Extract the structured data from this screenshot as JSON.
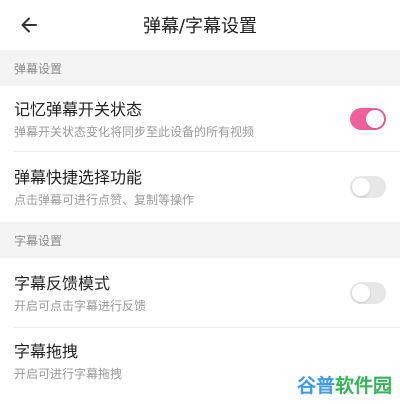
{
  "header": {
    "title": "弹幕/字幕设置",
    "back_icon": "arrow-left-icon"
  },
  "sections": [
    {
      "label": "弹幕设置",
      "items": [
        {
          "title": "记忆弹幕开关状态",
          "desc": "弹幕开关状态变化将同步至此设备的所有视频",
          "on": true
        },
        {
          "title": "弹幕快捷选择功能",
          "desc": "点击弹幕可进行点赞、复制等操作",
          "on": false
        }
      ]
    },
    {
      "label": "字幕设置",
      "items": [
        {
          "title": "字幕反馈模式",
          "desc": "开启可点击字幕进行反馈",
          "on": false
        },
        {
          "title": "字幕拖拽",
          "desc": "开启可进行字幕拖拽"
        }
      ]
    }
  ],
  "watermark": {
    "part1": "谷普",
    "part2": "软件园"
  },
  "colors": {
    "accent": "#f0609a",
    "toggle_off": "#e7e7e7",
    "section_bg": "#f4f4f4"
  }
}
